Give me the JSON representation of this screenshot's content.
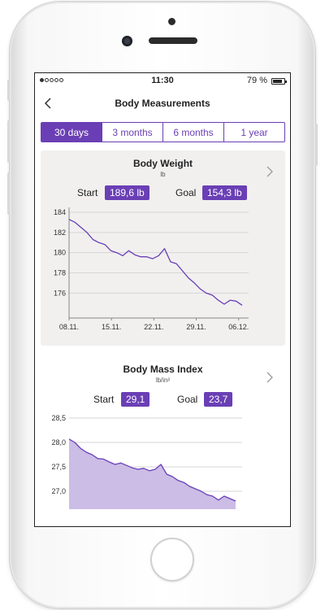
{
  "status": {
    "time": "11:30",
    "battery": "79 %"
  },
  "nav": {
    "title": "Body Measurements"
  },
  "segments": [
    {
      "label": "30 days",
      "active": true
    },
    {
      "label": "3 months",
      "active": false
    },
    {
      "label": "6 months",
      "active": false
    },
    {
      "label": "1 year",
      "active": false
    }
  ],
  "weight": {
    "title": "Body Weight",
    "unit": "lb",
    "start_label": "Start",
    "start_value": "189,6 lb",
    "goal_label": "Goal",
    "goal_value": "154,3 lb"
  },
  "bmi": {
    "title": "Body Mass Index",
    "unit": "lb/in²",
    "start_label": "Start",
    "start_value": "29,1",
    "goal_label": "Goal",
    "goal_value": "23,7"
  },
  "colors": {
    "accent": "#6a3fb5",
    "area_fill": "#cbbde6",
    "card_bg": "#f1f0ef"
  },
  "chart_data": [
    {
      "type": "line",
      "title": "Body Weight",
      "ylabel": "lb",
      "ylim": [
        174.5,
        184
      ],
      "yticks": [
        "184",
        "182",
        "180",
        "178",
        "176"
      ],
      "xticks": [
        "08.11.",
        "15.11.",
        "22.11.",
        "29.11.",
        "06.12."
      ],
      "x": [
        0,
        1,
        2,
        3,
        4,
        5,
        6,
        7,
        8,
        9,
        10,
        11,
        12,
        13,
        14,
        15,
        16,
        17,
        18,
        19,
        20,
        21,
        22,
        23,
        24,
        25,
        26,
        27,
        28,
        29
      ],
      "series": [
        {
          "values": [
            183.3,
            183.0,
            182.5,
            182.0,
            181.3,
            181.0,
            180.8,
            180.2,
            180.0,
            179.7,
            180.2,
            179.8,
            179.6,
            179.6,
            179.4,
            179.7,
            180.4,
            179.1,
            178.9,
            178.2,
            177.5,
            177.0,
            176.4,
            176.0,
            175.8,
            175.3,
            174.9,
            175.3,
            175.2,
            174.8
          ]
        }
      ],
      "grid": true
    },
    {
      "type": "area",
      "title": "Body Mass Index",
      "ylabel": "lb/in²",
      "ylim": [
        26.8,
        28.5
      ],
      "yticks": [
        "28,5",
        "28,0",
        "27,5",
        "27,0"
      ],
      "x": [
        0,
        1,
        2,
        3,
        4,
        5,
        6,
        7,
        8,
        9,
        10,
        11,
        12,
        13,
        14,
        15,
        16,
        17,
        18,
        19,
        20,
        21,
        22,
        23,
        24,
        25,
        26,
        27,
        28,
        29
      ],
      "series": [
        {
          "values": [
            28.07,
            28.0,
            27.88,
            27.8,
            27.75,
            27.67,
            27.66,
            27.6,
            27.55,
            27.58,
            27.53,
            27.48,
            27.45,
            27.47,
            27.42,
            27.45,
            27.55,
            27.35,
            27.3,
            27.22,
            27.18,
            27.1,
            27.05,
            27.0,
            26.93,
            26.9,
            26.82,
            26.9,
            26.85,
            26.8
          ]
        }
      ],
      "grid": true
    }
  ]
}
